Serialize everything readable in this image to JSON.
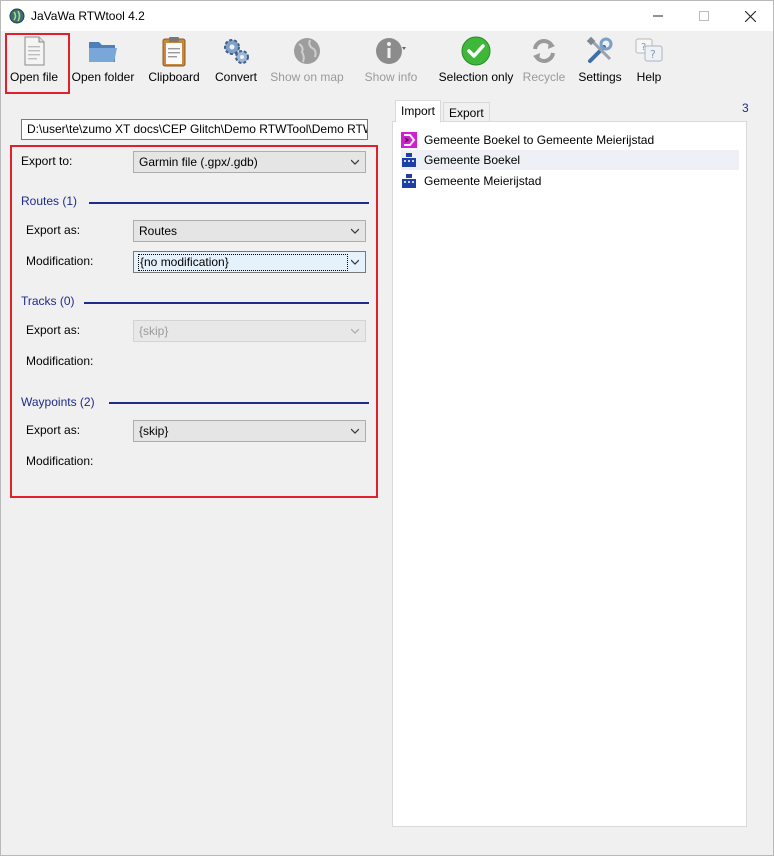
{
  "window": {
    "title": "JaVaWa RTWtool 4.2",
    "accent_highlight": "#e0202a"
  },
  "toolbar": {
    "items": [
      {
        "label": "Open file",
        "icon": "document-icon",
        "enabled": true
      },
      {
        "label": "Open folder",
        "icon": "folder-icon",
        "enabled": true
      },
      {
        "label": "Clipboard",
        "icon": "clipboard-icon",
        "enabled": true
      },
      {
        "label": "Convert",
        "icon": "gears-icon",
        "enabled": true
      },
      {
        "label": "Show on map",
        "icon": "globe-icon",
        "enabled": false
      },
      {
        "label": "Show info",
        "icon": "info-icon",
        "enabled": false
      },
      {
        "label": "Selection only",
        "icon": "checkmark-icon",
        "enabled": true
      },
      {
        "label": "Recycle",
        "icon": "recycle-icon",
        "enabled": false
      },
      {
        "label": "Settings",
        "icon": "tools-icon",
        "enabled": true
      },
      {
        "label": "Help",
        "icon": "help-icon",
        "enabled": true
      }
    ]
  },
  "file_path": "D:\\user\\te\\zumo XT docs\\CEP Glitch\\Demo RTWTool\\Demo RTW",
  "export": {
    "export_to_label": "Export to:",
    "export_to_value": "Garmin file (.gpx/.gdb)",
    "routes": {
      "title": "Routes (1)",
      "export_as_label": "Export as:",
      "export_as_value": "Routes",
      "modification_label": "Modification:",
      "modification_value": "{no modification}"
    },
    "tracks": {
      "title": "Tracks (0)",
      "export_as_label": "Export as:",
      "export_as_value": "{skip}",
      "modification_label": "Modification:"
    },
    "waypoints": {
      "title": "Waypoints (2)",
      "export_as_label": "Export as:",
      "export_as_value": "{skip}",
      "modification_label": "Modification:"
    }
  },
  "right_panel": {
    "tabs": [
      "Import",
      "Export"
    ],
    "count": "3",
    "items": [
      {
        "label": "Gemeente Boekel to Gemeente Meierijstad",
        "icon": "route-icon"
      },
      {
        "label": "Gemeente Boekel",
        "icon": "waypoint-icon"
      },
      {
        "label": "Gemeente Meierijstad",
        "icon": "waypoint-icon"
      }
    ]
  }
}
